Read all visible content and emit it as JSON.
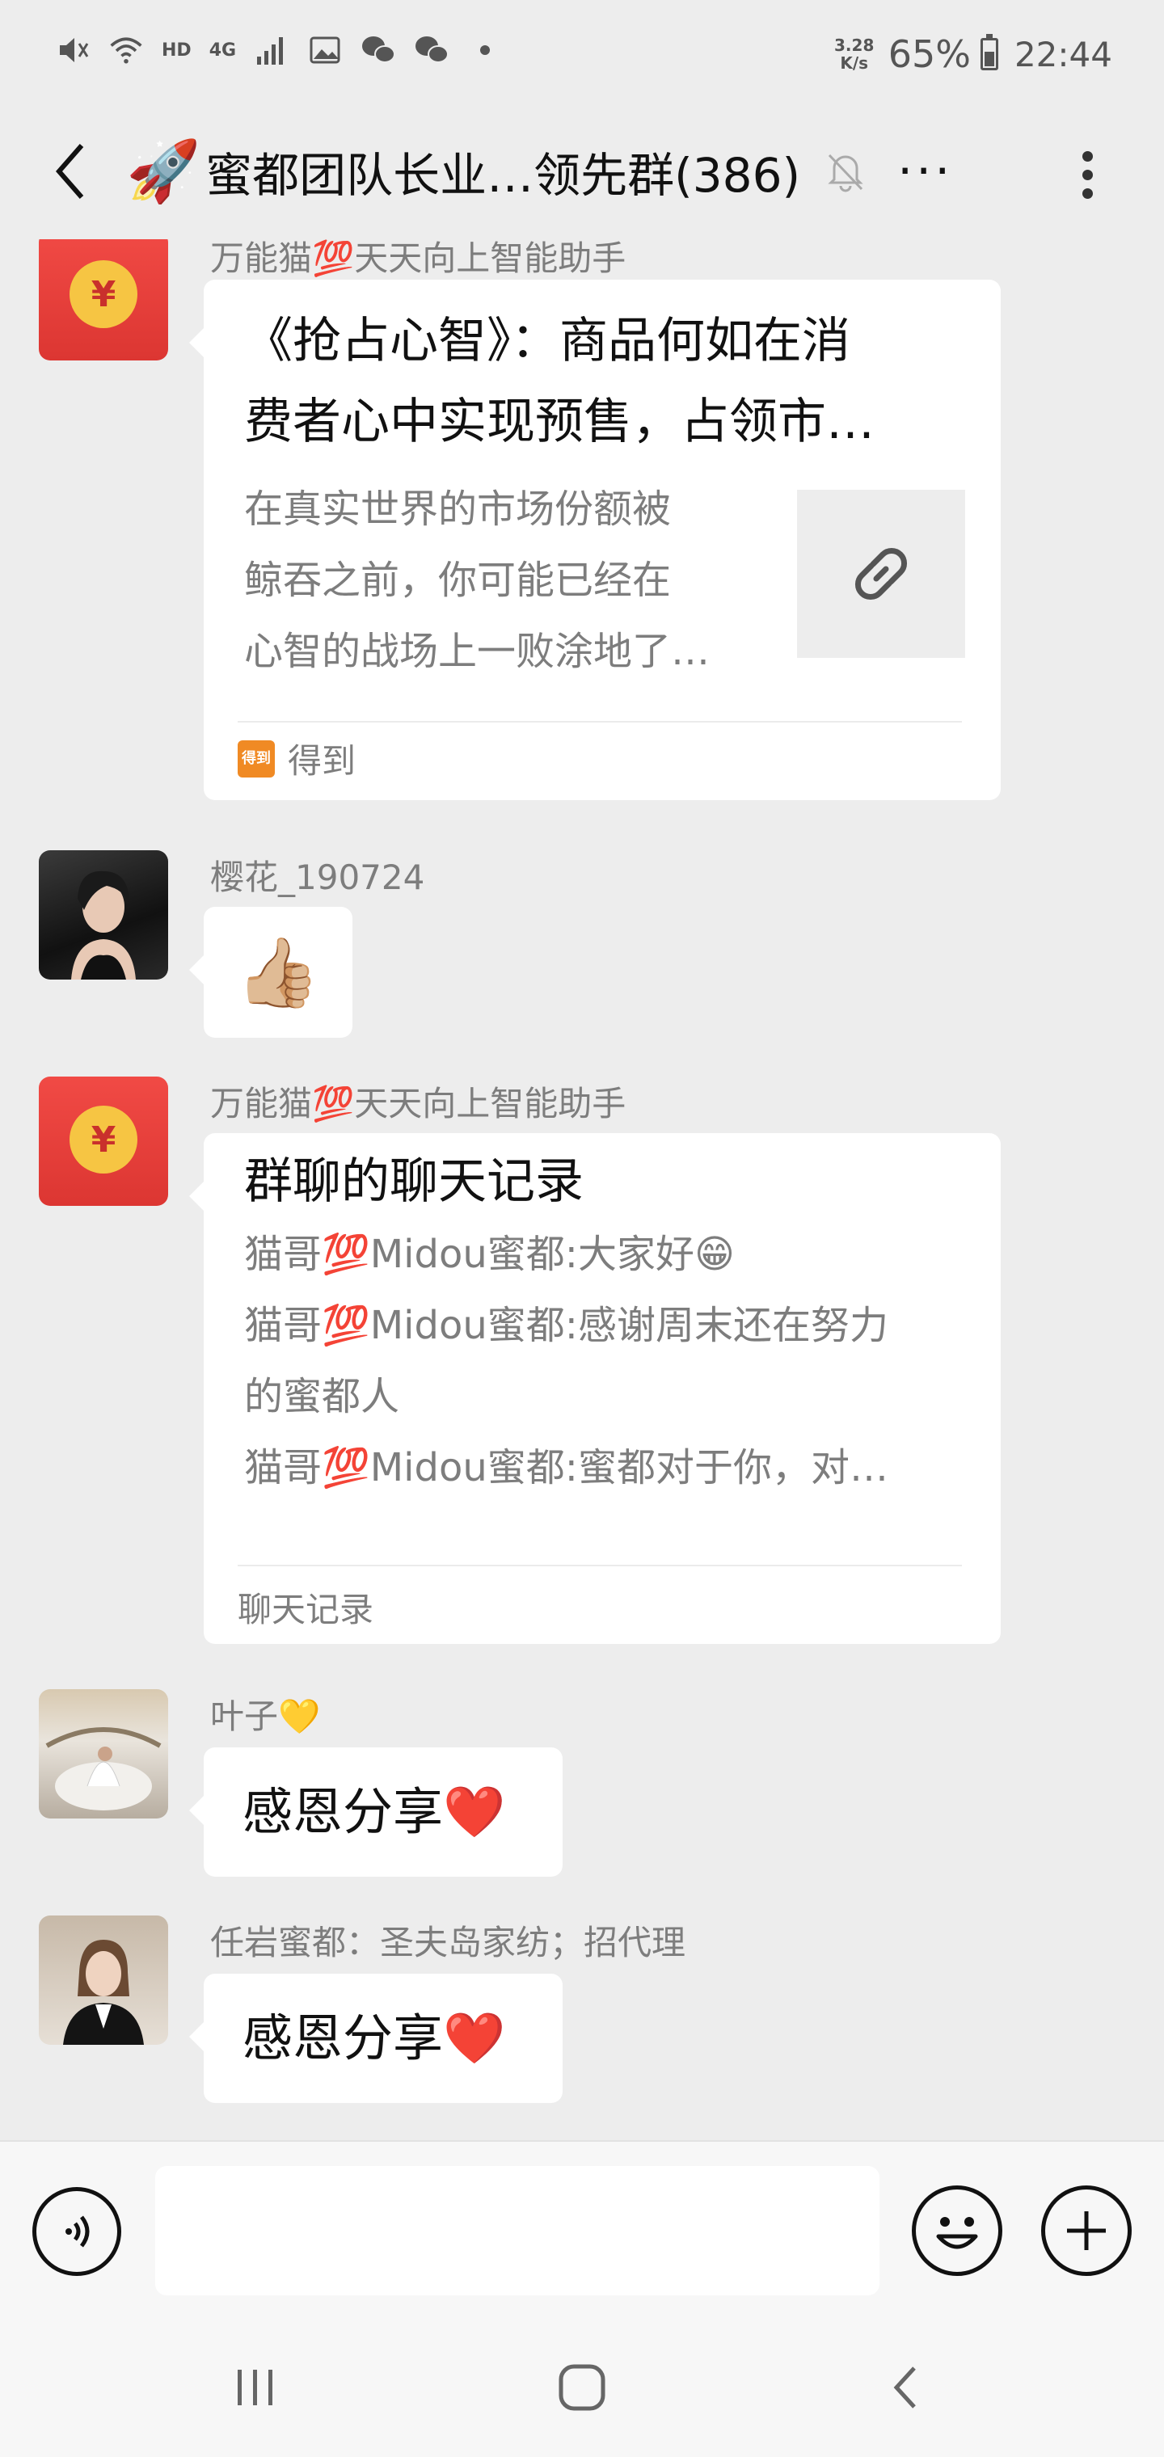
{
  "status_bar": {
    "net_speed_value": "3.28",
    "net_speed_unit": "K/s",
    "battery": "65%",
    "battery_level": 0.65,
    "time": "22:44",
    "hd_label": "HD",
    "network_label": "4G",
    "icons": [
      "mute-icon",
      "wifi-icon",
      "signal-icon",
      "gallery-icon",
      "wechat-icon",
      "wechat-icon",
      "dot-icon"
    ]
  },
  "header": {
    "title_emoji": "🚀",
    "title": "蜜都团队长业…领先群(386)",
    "ellipsis": "···"
  },
  "messages": [
    {
      "type": "link-card",
      "sender": "万能猫💯天天向上智能助手",
      "title_line1": "《抢占心智》：商品何如在消",
      "title_line2": "费者心中实现预售，占领市…",
      "desc_line1": "在真实世界的市场份额被",
      "desc_line2": "鲸吞之前，你可能已经在",
      "desc_line3": "心智的战场上一败涂地了…",
      "source_icon_text": "得到",
      "source": "得到"
    },
    {
      "type": "emoji",
      "sender": "樱花_190724",
      "content": "👍🏼"
    },
    {
      "type": "chat-history",
      "sender": "万能猫💯天天向上智能助手",
      "title": "群聊的聊天记录",
      "line1": "猫哥💯Midou蜜都:大家好😁",
      "line2": "猫哥💯Midou蜜都:感谢周末还在努力",
      "line3": "的蜜都人",
      "line4": "猫哥💯Midou蜜都:蜜都对于你，对…",
      "footer": "聊天记录"
    },
    {
      "type": "text",
      "sender": "叶子💛",
      "content": "感恩分享❤️"
    },
    {
      "type": "text",
      "sender": "任岩蜜都：圣夫岛家纺；招代理",
      "content": "感恩分享❤️"
    }
  ],
  "input": {
    "value": "",
    "placeholder": ""
  },
  "colors": {
    "background": "#ededed",
    "bubble": "#ffffff",
    "red_packet": "#e0322f",
    "coin": "#f6c543",
    "secondary_text": "#7d7d7d"
  }
}
